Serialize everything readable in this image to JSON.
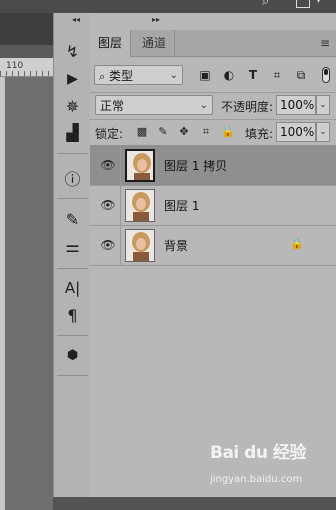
{
  "top": {
    "icons": [
      "search-icon",
      "workspace-icon",
      "chevron-down-icon"
    ]
  },
  "document": {
    "ruler_value": "110"
  },
  "toolbar": {
    "collapse_glyph": "◂◂",
    "tools": [
      {
        "name": "history-brush-icon",
        "glyph": "↯"
      },
      {
        "name": "play-action-icon",
        "glyph": "▶"
      },
      {
        "name": "navigator-wheel-icon",
        "glyph": "✵"
      },
      {
        "name": "histogram-icon",
        "glyph": "▟"
      },
      {
        "name": "info-icon",
        "glyph": "ⓘ"
      },
      {
        "name": "brush-presets-icon",
        "glyph": "✎"
      },
      {
        "name": "adjust-sliders-icon",
        "glyph": "⚌"
      },
      {
        "name": "character-icon",
        "glyph": "A|"
      },
      {
        "name": "paragraph-icon",
        "glyph": "¶"
      },
      {
        "name": "3d-cube-icon",
        "glyph": "⬢"
      }
    ]
  },
  "panel": {
    "collapse_glyph": "▸▸",
    "tabs": [
      {
        "label": "图层"
      },
      {
        "label": "通道"
      }
    ],
    "menu_glyph": "≡",
    "filter": {
      "label": "类型",
      "prefix_icon": "search-icon",
      "icons": [
        "image-filter-icon",
        "adjustment-filter-icon",
        "type-filter-icon",
        "shape-filter-icon",
        "smart-object-filter-icon"
      ]
    },
    "blend_mode": "正常",
    "opacity_label": "不透明度:",
    "opacity_value": "100%",
    "lock_label": "锁定:",
    "fill_label": "填充:",
    "fill_value": "100%",
    "lock_icons": [
      "lock-transparent-icon",
      "lock-paint-icon",
      "lock-move-icon",
      "lock-artboard-icon",
      "lock-all-icon"
    ]
  },
  "layers": [
    {
      "name": "图层 1 拷贝",
      "visible": true,
      "selected": true,
      "locked": false
    },
    {
      "name": "图层 1",
      "visible": true,
      "selected": false,
      "locked": false
    },
    {
      "name": "背景",
      "visible": true,
      "selected": false,
      "locked": true
    }
  ],
  "watermark": {
    "logo": "Bai du 经验",
    "url": "jingyan.baidu.com"
  }
}
